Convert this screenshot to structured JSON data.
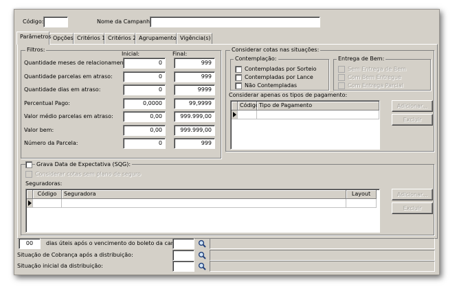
{
  "header": {
    "codigo_label": "Código:",
    "codigo_value": "",
    "campanha_label": "Nome da Campanha:",
    "campanha_value": ""
  },
  "tabs": [
    {
      "label": "Parâmetros",
      "active": true
    },
    {
      "label": "Opções"
    },
    {
      "label": "Critérios 1"
    },
    {
      "label": "Critérios 2"
    },
    {
      "label": "Agrupamento"
    },
    {
      "label": "Vigência(s)"
    }
  ],
  "filtros": {
    "title": "Filtros:",
    "col_inicial": "Inicial:",
    "col_final": "Final:",
    "rows": [
      {
        "label": "Quantidade meses de relacionamento:",
        "inicial": "0",
        "final": "999"
      },
      {
        "label": "Quantidade parcelas em atraso:",
        "inicial": "0",
        "final": "999"
      },
      {
        "label": "Quantidade dias em atraso:",
        "inicial": "0",
        "final": "9999"
      },
      {
        "label": "Percentual Pago:",
        "inicial": "0,0000",
        "final": "99,9999"
      },
      {
        "label": "Valor médio parcelas em atraso:",
        "inicial": "0,00",
        "final": "999.999,00"
      },
      {
        "label": "Valor bem:",
        "inicial": "0,00",
        "final": "999.999,00"
      },
      {
        "label": "Número da Parcela:",
        "inicial": "0",
        "final": "999"
      }
    ]
  },
  "situacoes": {
    "title": "Considerar cotas nas situações:",
    "contemplacao": {
      "title": "Contemplação:",
      "items": [
        "Contempladas por Sorteio",
        "Contempladas por Lance",
        "Não Contempladas"
      ]
    },
    "entrega": {
      "title": "Entrega de Bem:",
      "items": [
        "Sem Entrega de Bem",
        "Com Bem Entregue",
        "Com Entrega Parcial"
      ]
    }
  },
  "pagamento": {
    "title": "Considerar apenas os tipos de pagamento:",
    "columns": [
      "Código",
      "Tipo de Pagamento"
    ],
    "add_label": "Adicionar...",
    "remove_label": "Excluir"
  },
  "sqg": {
    "grava_label": "Grava Data de Expectativa (SQG):",
    "seguro_label": "Considerar cotas sem plano de seguro"
  },
  "seguradoras": {
    "title": "Seguradoras:",
    "columns": [
      "Código",
      "Seguradora",
      "Layout"
    ],
    "add_label": "Adicionar...",
    "remove_label": "Excluir"
  },
  "bottom": {
    "dias_value": "00",
    "dias_label": "dias úteis após o vencimento do boleto da carta:",
    "cobranca_label": "Situação de Cobrança após a distribuição:",
    "inicial_label": "Situação inicial da distribuição:"
  }
}
